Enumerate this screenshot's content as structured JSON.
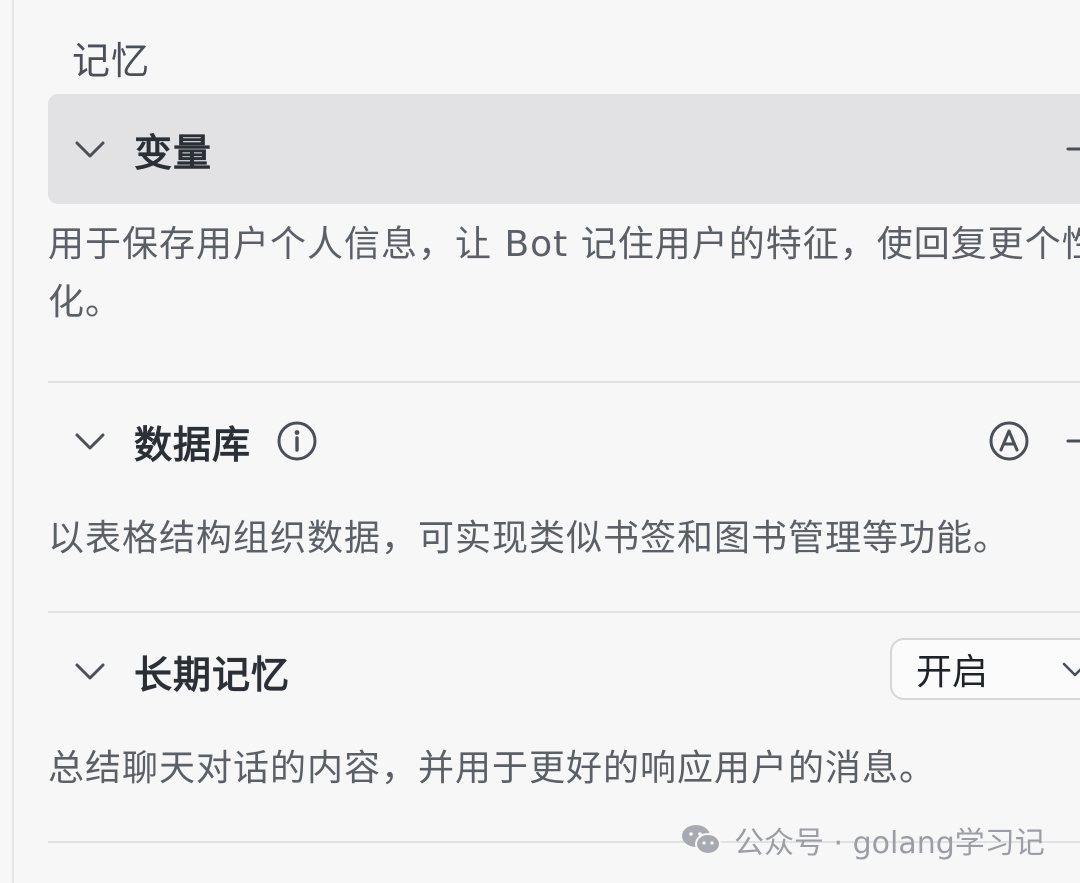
{
  "memory": {
    "title": "记忆",
    "variables": {
      "title": "变量",
      "description": "用于保存用户个人信息，让 Bot 记住用户的特征，使回复更个性化。"
    },
    "database": {
      "title": "数据库",
      "description": "以表格结构组织数据，可实现类似书签和图书管理等功能。"
    },
    "long_term": {
      "title": "长期记忆",
      "select_value": "开启",
      "description": "总结聊天对话的内容，并用于更好的响应用户的消息。"
    }
  },
  "watermark": {
    "text": "公众号 · golang学习记"
  },
  "icons": {
    "collapse": "chevron-down-icon",
    "add": "plus-icon",
    "info": "info-icon",
    "auto": "auto-a-icon",
    "watermark": "wechat-icon"
  },
  "colors": {
    "active_header_bg": "#e2e2e4",
    "text_primary": "#2b2f36",
    "text_secondary": "#5b5f66"
  }
}
